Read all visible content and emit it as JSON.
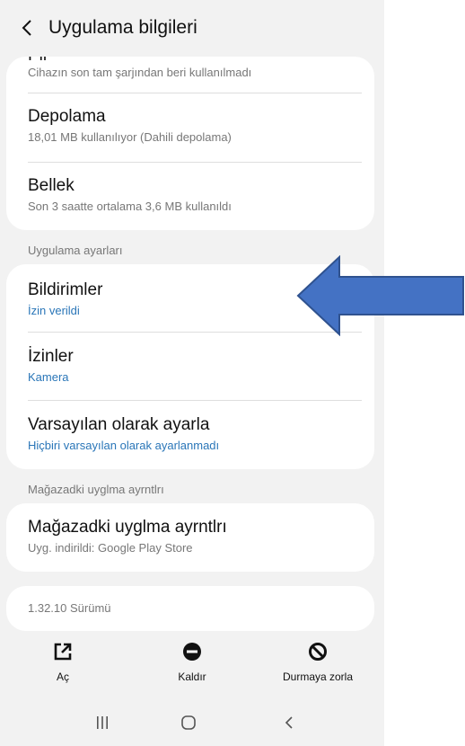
{
  "header": {
    "title": "Uygulama bilgileri",
    "back_icon": "back-chevron-icon"
  },
  "usage_card": {
    "clipped_title": "Pil",
    "battery_subtitle": "Cihazın son tam şarjından beri kullanılmadı",
    "storage": {
      "title": "Depolama",
      "subtitle": "18,01 MB kullanılıyor (Dahili depolama)"
    },
    "memory": {
      "title": "Bellek",
      "subtitle": "Son 3 saatte ortalama 3,6 MB kullanıldı"
    }
  },
  "app_settings": {
    "section_label": "Uygulama ayarları",
    "notifications": {
      "title": "Bildirimler",
      "subtitle": "İzin verildi"
    },
    "permissions": {
      "title": "İzinler",
      "subtitle": "Kamera"
    },
    "defaults": {
      "title": "Varsayılan olarak ayarla",
      "subtitle": "Hiçbiri varsayılan olarak ayarlanmadı"
    }
  },
  "store": {
    "section_label": "Mağazadki uyglma ayrntlrı",
    "title": "Mağazadki uyglma ayrntlrı",
    "subtitle": "Uyg. indirildi: Google Play Store"
  },
  "version": {
    "text": "1.32.10 Sürümü"
  },
  "actions": {
    "open": {
      "label": "Aç",
      "icon": "open-external-icon"
    },
    "uninstall": {
      "label": "Kaldır",
      "icon": "minus-circle-icon"
    },
    "force_stop": {
      "label": "Durmaya zorla",
      "icon": "block-icon"
    }
  },
  "nav": {
    "recents_icon": "recents-icon",
    "home_icon": "home-icon",
    "back_icon": "nav-back-icon"
  },
  "colors": {
    "accent_blue": "#2a76b8",
    "arrow_fill": "#4472c4",
    "arrow_stroke": "#2f528f",
    "background": "#f2f2f2"
  }
}
